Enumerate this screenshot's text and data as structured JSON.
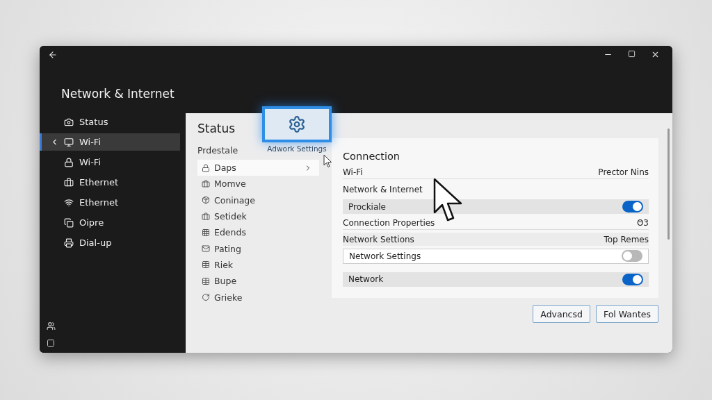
{
  "sidebar": {
    "title": "Network & Internet",
    "items": [
      {
        "label": "Status",
        "selected": false
      },
      {
        "label": "Wi-Fi",
        "selected": true
      },
      {
        "label": "Wi-Fi",
        "selected": false
      },
      {
        "label": "Ethernet",
        "selected": false
      },
      {
        "label": "Ethernet",
        "selected": false
      },
      {
        "label": "Oipre",
        "selected": false
      },
      {
        "label": "Dial-up",
        "selected": false
      }
    ]
  },
  "status": {
    "heading": "Status",
    "subheading": "Prdestale",
    "items": [
      {
        "label": "Daps",
        "selected": true
      },
      {
        "label": "Momve",
        "selected": false
      },
      {
        "label": "Coninage",
        "selected": false
      },
      {
        "label": "Setidek",
        "selected": false
      },
      {
        "label": "Edends",
        "selected": false
      },
      {
        "label": "Pating",
        "selected": false
      },
      {
        "label": "Riek",
        "selected": false
      },
      {
        "label": "Bupe",
        "selected": false
      },
      {
        "label": "Grieke",
        "selected": false
      }
    ]
  },
  "settings_tile": {
    "caption": "Adwork Settings"
  },
  "connection": {
    "title": "Connection",
    "rows": [
      {
        "kind": "info",
        "label": "Wi-Fi",
        "value": "Prector Nins",
        "shaded": false
      },
      {
        "kind": "heading",
        "label": "Network & Internet"
      },
      {
        "kind": "toggle",
        "label": "Prockiale",
        "on": true
      },
      {
        "kind": "info",
        "label": "Connection Properties",
        "value": "Θ3",
        "shaded": false
      },
      {
        "kind": "info",
        "label": "Network Settions",
        "value": "Top Remes",
        "shaded": true
      },
      {
        "kind": "field",
        "label": "Network Settings",
        "on": false
      },
      {
        "kind": "toggle",
        "label": "Network",
        "on": true
      }
    ]
  },
  "buttons": [
    "Advancsd",
    "Fol Wantes"
  ]
}
